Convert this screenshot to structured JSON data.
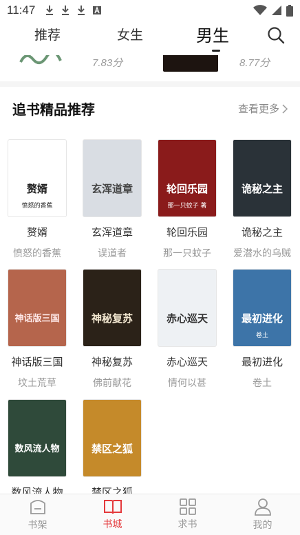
{
  "status_bar": {
    "time": "11:47"
  },
  "top_tabs": [
    {
      "label": "推荐",
      "active": false
    },
    {
      "label": "女生",
      "active": false
    },
    {
      "label": "男生",
      "active": true
    }
  ],
  "prev_row": {
    "score_left": "7.83分",
    "score_right": "8.77分"
  },
  "section": {
    "title": "追书精品推荐",
    "more_label": "查看更多"
  },
  "books": [
    {
      "title": "赘婿",
      "author": "愤怒的香蕉",
      "cover_text": "赘婿",
      "cover_sub": "愤怒的香蕉",
      "cover_bg": "#ffffff",
      "cover_fg": "#222222"
    },
    {
      "title": "玄浑道章",
      "author": "误道者",
      "cover_text": "玄浑道章",
      "cover_sub": "",
      "cover_bg": "#d9dde3",
      "cover_fg": "#444444"
    },
    {
      "title": "轮回乐园",
      "author": "那一只蚊子",
      "cover_text": "轮回乐园",
      "cover_sub": "那一只蚊子 著",
      "cover_bg": "#8a1b1b",
      "cover_fg": "#ffffff"
    },
    {
      "title": "诡秘之主",
      "author": "爱潜水的乌贼",
      "cover_text": "诡秘之主",
      "cover_sub": "",
      "cover_bg": "#2a3238",
      "cover_fg": "#ffffff"
    },
    {
      "title": "神话版三国",
      "author": "坟土荒草",
      "cover_text": "神话版三国",
      "cover_sub": "",
      "cover_bg": "#b5654c",
      "cover_fg": "#ffe9e9"
    },
    {
      "title": "神秘复苏",
      "author": "佛前献花",
      "cover_text": "神秘复苏",
      "cover_sub": "",
      "cover_bg": "#2b2218",
      "cover_fg": "#f1e6cf"
    },
    {
      "title": "赤心巡天",
      "author": "情何以甚",
      "cover_text": "赤心巡天",
      "cover_sub": "",
      "cover_bg": "#eef1f4",
      "cover_fg": "#333333"
    },
    {
      "title": "最初进化",
      "author": "卷土",
      "cover_text": "最初进化",
      "cover_sub": "卷土",
      "cover_bg": "#3d74a8",
      "cover_fg": "#ffffff"
    },
    {
      "title": "数风流人物",
      "author": "",
      "cover_text": "数风流人物",
      "cover_sub": "",
      "cover_bg": "#2f4a3a",
      "cover_fg": "#ffffff"
    },
    {
      "title": "禁区之狐",
      "author": "",
      "cover_text": "禁区之狐",
      "cover_sub": "",
      "cover_bg": "#c58a2a",
      "cover_fg": "#ffffff"
    }
  ],
  "bottom_nav": [
    {
      "label": "书架",
      "icon": "bookshelf-icon",
      "active": false
    },
    {
      "label": "书城",
      "icon": "open-book-icon",
      "active": true
    },
    {
      "label": "求书",
      "icon": "grid-icon",
      "active": false
    },
    {
      "label": "我的",
      "icon": "user-icon",
      "active": false
    }
  ],
  "colors": {
    "accent": "#e4393c",
    "muted": "#999999"
  }
}
